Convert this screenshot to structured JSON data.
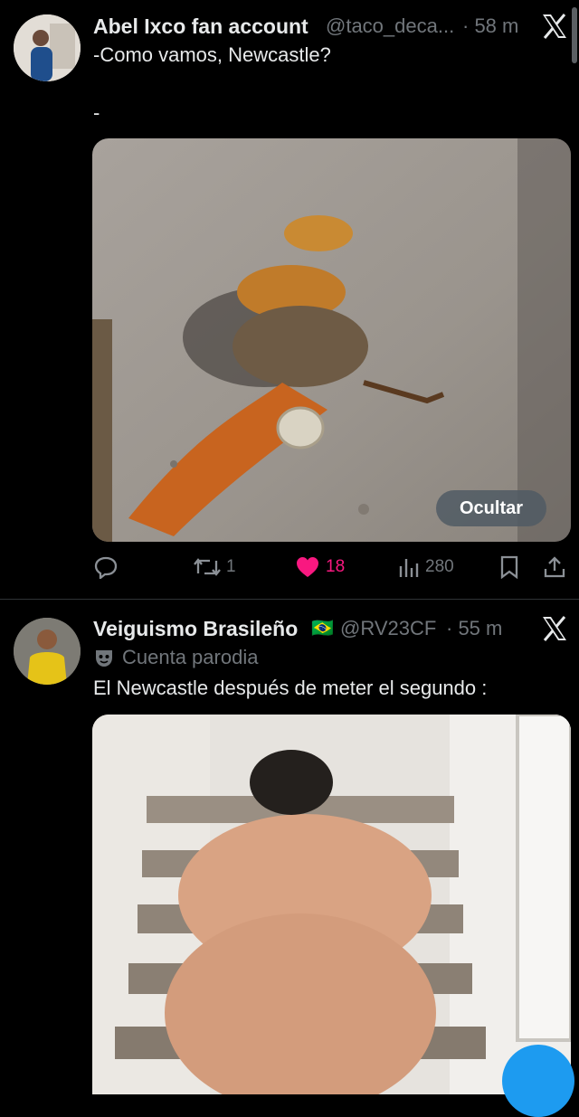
{
  "tweets": [
    {
      "author_name": "Abel Ixco fan account",
      "handle": "@taco_deca...",
      "time": "· 58 m",
      "text_line1": "-Como vamos, Newcastle?",
      "text_line2": "-",
      "hide_label": "Ocultar",
      "actions": {
        "replies": "",
        "retweets": "1",
        "likes": "18",
        "views": "280"
      },
      "icons": [
        "reply-icon",
        "retweet-icon",
        "heart-icon",
        "views-icon",
        "bookmark-icon",
        "share-icon",
        "x-logo-icon"
      ]
    },
    {
      "author_name": "Veiguismo Brasileño",
      "flag": "🇧🇷",
      "handle": "@RV23CF",
      "time": "· 55 m",
      "label": "Cuenta parodia",
      "text_line1": "El Newcastle después de meter el segundo :",
      "icons": [
        "parody-mask-icon",
        "x-logo-icon",
        "compose-fab"
      ]
    }
  ],
  "colors": {
    "background": "#000000",
    "like": "#f91880",
    "muted": "#71767b",
    "accent": "#1d9bf0"
  }
}
